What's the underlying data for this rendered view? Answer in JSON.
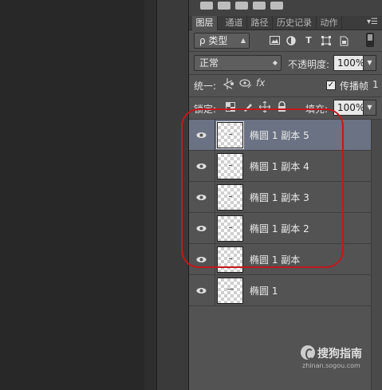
{
  "tabs": [
    {
      "label": "图层",
      "active": true
    },
    {
      "label": "通道",
      "active": false
    },
    {
      "label": "路径",
      "active": false
    },
    {
      "label": "历史记录",
      "active": false
    },
    {
      "label": "动作",
      "active": false
    }
  ],
  "tab_menu_icon": "panel-menu-icon",
  "filter": {
    "search_icon": "search-icon",
    "kind_label": "ρ 类型",
    "icons": [
      "image-filter-icon",
      "adjustment-filter-icon",
      "text-filter-icon",
      "shape-filter-icon",
      "smart-object-filter-icon"
    ]
  },
  "blend": {
    "mode": "正常",
    "opacity_label": "不透明度:",
    "opacity_value": "100%"
  },
  "unify": {
    "label": "统一:",
    "propagate_label": "传播帧",
    "propagate_checked": true,
    "propagate_suffix": "1"
  },
  "lock": {
    "label": "锁定:",
    "fill_label": "填充:",
    "fill_value": "100%"
  },
  "layers": [
    {
      "name": "椭圆 1 副本 5",
      "selected": true,
      "visible": true
    },
    {
      "name": "椭圆 1 副本 4",
      "selected": false,
      "visible": true
    },
    {
      "name": "椭圆 1 副本 3",
      "selected": false,
      "visible": true
    },
    {
      "name": "椭圆 1 副本 2",
      "selected": false,
      "visible": true
    },
    {
      "name": "椭圆 1 副本",
      "selected": false,
      "visible": true
    },
    {
      "name": "椭圆 1",
      "selected": false,
      "visible": true
    }
  ],
  "watermark": {
    "brand": "搜狗指南",
    "url": "zhinan.sogou.com"
  },
  "colors": {
    "panel_bg": "#535353",
    "selected_row": "#6a7283",
    "highlight_ring": "#c4171d"
  }
}
